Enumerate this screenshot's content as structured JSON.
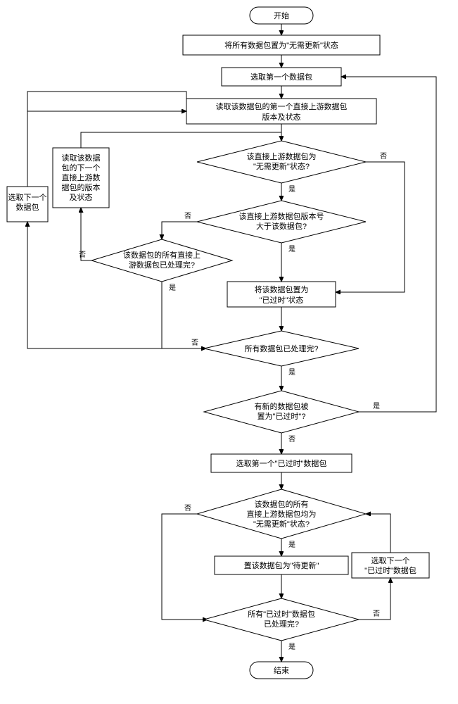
{
  "chart_data": {
    "type": "flowchart",
    "title": "",
    "nodes": {
      "start": "开始",
      "end": "结束",
      "p1": "将所有数据包置为\"无需更新\"状态",
      "p2": "选取第一个数据包",
      "p3": "读取该数据包的第一个直接上游数据包版本及状态",
      "d1": "该直接上游数据包为\"无需更新\"状态?",
      "d2": "该直接上游数据包版本号大于该数据包?",
      "d3": "该数据包的所有直接上游数据包已处理完?",
      "p4": "将该数据包置为\"已过时\"状态",
      "p5": "读取该数据包的下一个直接上游数据包的版本及状态",
      "p6": "选取下一个数据包",
      "d4": "所有数据包已处理完?",
      "d5": "有新的数据包被置为\"已过时\"?",
      "p7": "选取第一个\"已过时\"数据包",
      "d6": "该数据包的所有直接上游数据包均为\"无需更新\"状态?",
      "p8": "置该数据包为\"待更新\"",
      "p9": "选取下一个\"已过时\"数据包",
      "d7": "所有\"已过时\"数据包已处理完?"
    },
    "edge_labels": {
      "yes": "是",
      "no": "否"
    }
  }
}
